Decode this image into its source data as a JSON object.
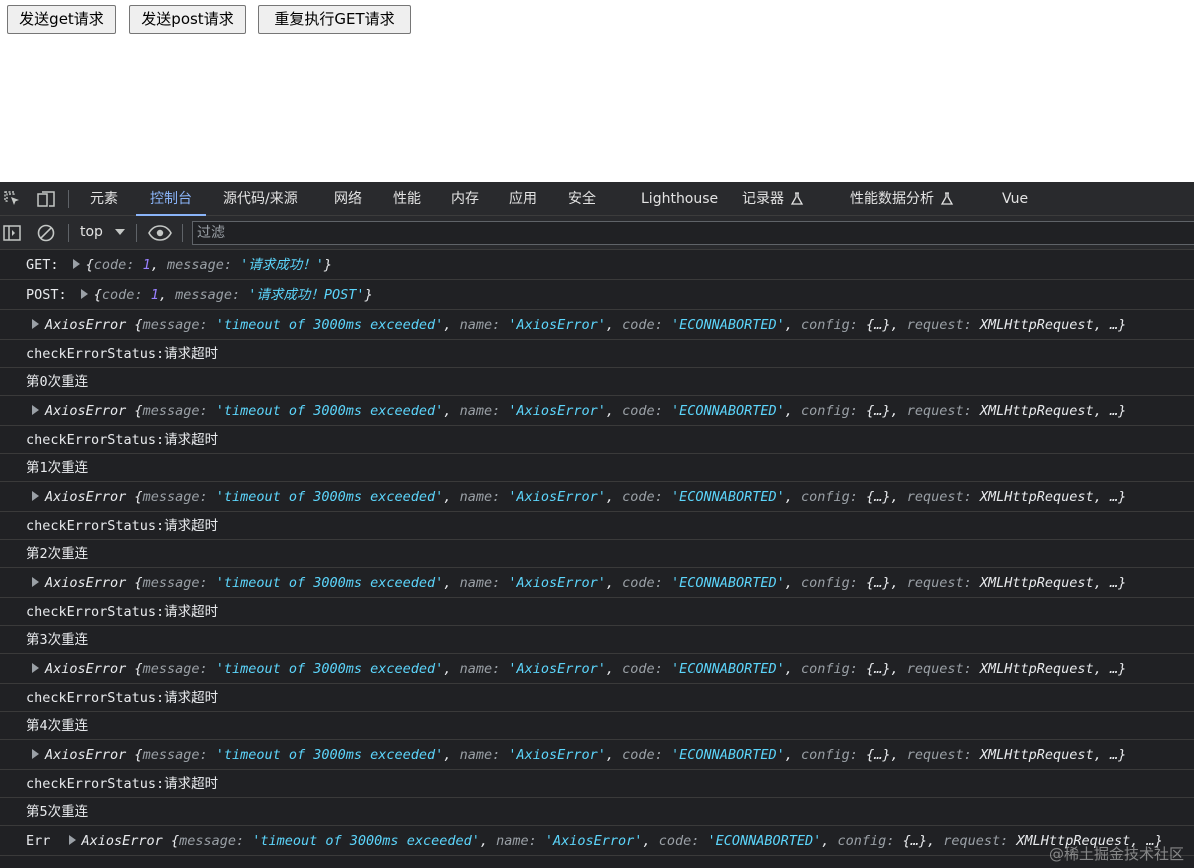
{
  "page": {
    "buttons": [
      "发送get请求",
      "发送post请求",
      "重复执行GET请求"
    ]
  },
  "devtools": {
    "tabs": [
      "元素",
      "控制台",
      "源代码/来源",
      "网络",
      "性能",
      "内存",
      "应用",
      "安全",
      "Lighthouse",
      "记录器",
      "性能数据分析",
      "Vue"
    ],
    "active_tab": "控制台",
    "context": "top",
    "filter_placeholder": "过滤",
    "accent": "#8ab4f8"
  },
  "console": {
    "get": {
      "prefix": "GET:",
      "open": "{",
      "k1": "code",
      "v1": "1",
      "k2": "message",
      "v2": "'请求成功！'",
      "close": "}"
    },
    "post": {
      "prefix": "POST:",
      "open": "{",
      "k1": "code",
      "v1": "1",
      "k2": "message",
      "v2": "'请求成功！POST'",
      "close": "}"
    },
    "error": {
      "type": "AxiosError",
      "open": "{",
      "k1": "message",
      "v1": "'timeout of 3000ms exceeded'",
      "k2": "name",
      "v2": "'AxiosError'",
      "k3": "code",
      "v3": "'ECONNABORTED'",
      "k4": "config",
      "v4": "{…}",
      "k5": "request",
      "v5": "XMLHttpRequest",
      "tail": "…}"
    },
    "status_text": "checkErrorStatus:请求超时",
    "retries": [
      "第0次重连",
      "第1次重连",
      "第2次重连",
      "第3次重连",
      "第4次重连",
      "第5次重连"
    ],
    "final_prefix": "Err",
    "final_tail": ", …}"
  },
  "watermark": "@稀土掘金技术社区"
}
